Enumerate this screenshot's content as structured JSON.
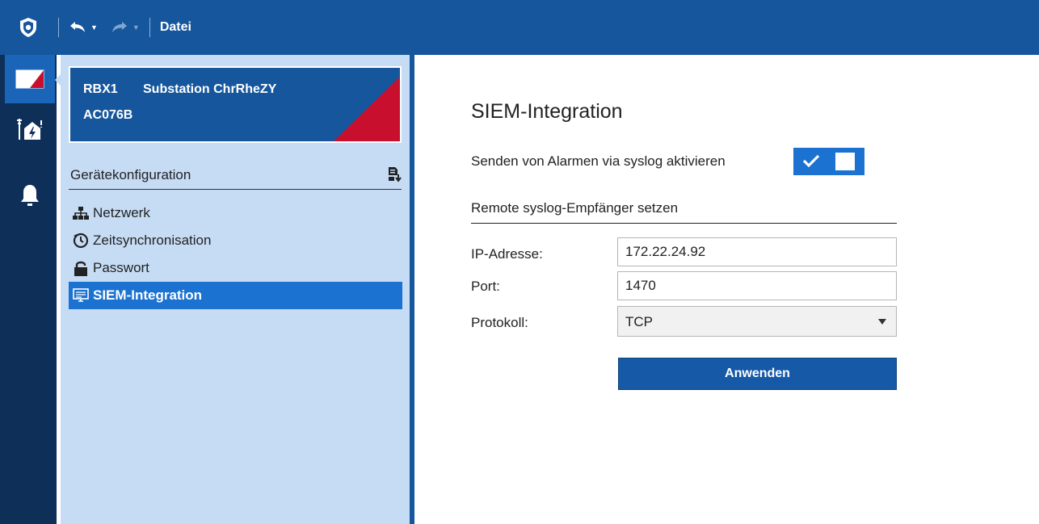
{
  "toolbar": {
    "menu_label": "Datei",
    "icons": [
      "shield-logo-icon",
      "undo-icon",
      "redo-icon"
    ]
  },
  "rail": {
    "items": [
      "device-icon",
      "substation-icon",
      "bell-icon"
    ]
  },
  "device": {
    "id": "RBX1",
    "name": "Substation ChrRheZY",
    "serial": "AC076B"
  },
  "config": {
    "section_title": "Gerätekonfiguration",
    "items": [
      {
        "label": "Netzwerk",
        "icon": "network-icon"
      },
      {
        "label": "Zeitsynchronisation",
        "icon": "clock-sync-icon"
      },
      {
        "label": "Passwort",
        "icon": "lock-icon"
      },
      {
        "label": "SIEM-Integration",
        "icon": "monitor-icon"
      }
    ]
  },
  "main": {
    "title": "SIEM-Integration",
    "toggle_label": "Senden von Alarmen via syslog aktivieren",
    "toggle_on": true,
    "subsection": "Remote syslog-Empfänger setzen",
    "ip_label": "IP-Adresse:",
    "ip_value": "172.22.24.92",
    "port_label": "Port:",
    "port_value": "1470",
    "protocol_label": "Protokoll:",
    "protocol_value": "TCP",
    "apply_label": "Anwenden"
  },
  "colors": {
    "header": "#16569c",
    "rail": "#0e2f57",
    "nav_bg": "#c6dcf5",
    "accent": "#1b72d1",
    "red_corner": "#c8102e"
  }
}
